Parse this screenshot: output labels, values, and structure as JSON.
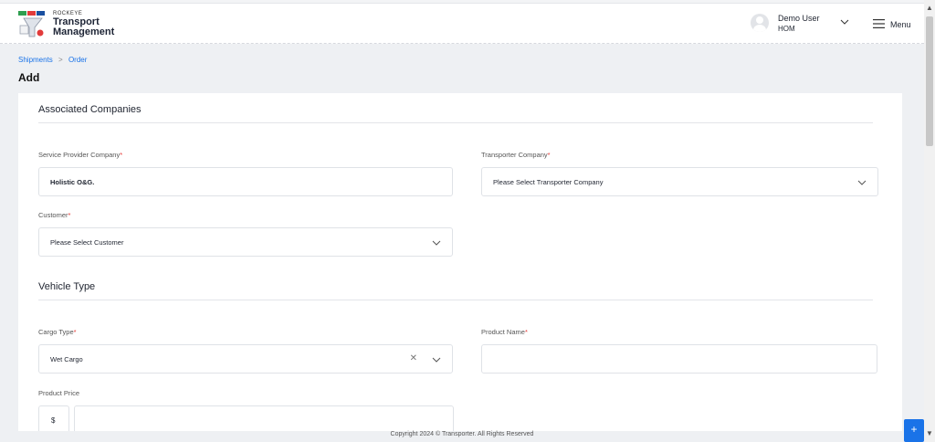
{
  "brand": {
    "top": "ROCKEYE",
    "line1": "Transport",
    "line2": "Management"
  },
  "user": {
    "name": "Demo User",
    "role": "HOM"
  },
  "menu": {
    "label": "Menu"
  },
  "breadcrumb": {
    "items": [
      "Shipments",
      "Order"
    ]
  },
  "page": {
    "title": "Add"
  },
  "sections": {
    "associated": "Associated Companies",
    "vehicle": "Vehicle Type"
  },
  "fields": {
    "service_provider": {
      "label": "Service Provider Company",
      "value": "Holistic O&G."
    },
    "transporter": {
      "label": "Transporter Company",
      "placeholder": "Please Select Transporter Company"
    },
    "customer": {
      "label": "Customer",
      "placeholder": "Please Select Customer"
    },
    "cargo_type": {
      "label": "Cargo Type",
      "value": "Wet Cargo"
    },
    "product_name": {
      "label": "Product Name",
      "value": ""
    },
    "product_price": {
      "label": "Product Price",
      "prefix": "$",
      "value": ""
    }
  },
  "required_mark": "*",
  "footer": {
    "text": "Copyright 2024 © Transporter. All Rights Reserved"
  },
  "fab": {
    "label": "+"
  },
  "colors": {
    "accent": "#1a73e8",
    "required": "#e53935"
  }
}
